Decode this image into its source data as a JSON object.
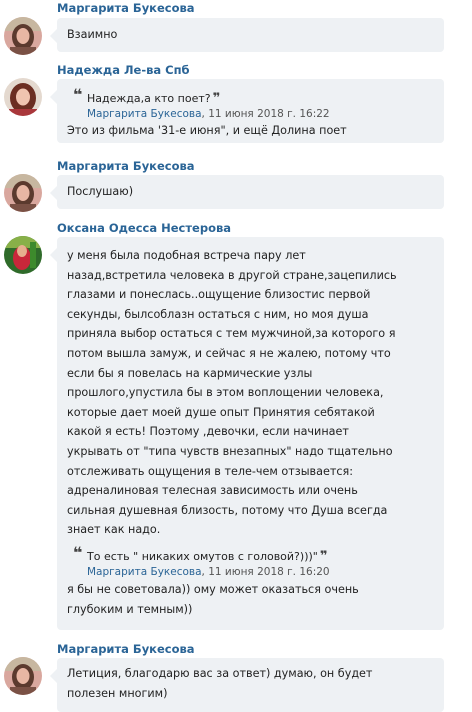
{
  "messages": [
    {
      "author": "Маргарита Букесова",
      "avatar": "avatar-margarita",
      "text_lines": [
        "Взаимно"
      ]
    },
    {
      "author": "Надежда Ле-ва Спб",
      "avatar": "avatar-nadezhda",
      "quote": {
        "text": "Надежда,а кто поет?",
        "author": "Маргарита Букесова",
        "date": ", 11 июня 2018 г. 16:22"
      },
      "text_lines": [
        "Это из фильма '31-е июня\", и ещё Долина поет"
      ]
    },
    {
      "author": "Маргарита Букесова",
      "avatar": "avatar-margarita",
      "text_lines": [
        "Послушаю)"
      ]
    },
    {
      "author": "Оксана Одесса Нестерова",
      "avatar": "avatar-oksana",
      "text_lines": [
        "у меня была подобная встреча пару лет",
        "назад,встретила человека в другой стране,зацепились",
        "глазами и понеслась..ощущение близостис первой",
        "секунды, былсоблазн остаться с ним, но моя душа",
        "приняла выбор остаться с тем мужчиной,за которого я",
        "потом вышла замуж, и сейчас я не жалею, потому что",
        "если бы я повелась на кармические узлы",
        "прошлого,упустила бы в этом воплощении человека,",
        "которые дает моей душе опыт Принятия себятакой",
        "какой я есть! Поэтому ,девочки, если начинает",
        "укрывать от \"типа чувств внезапных\" надо тщательно",
        "отслеживать ощущения в теле-чем отзывается:",
        "адреналиновая телесная  зависимость или очень",
        "сильная душевная близость, потому что Душа всегда",
        "знает как надо."
      ],
      "quote": {
        "text": "То есть \" никаких омутов с головой?)))\"",
        "author": "Маргарита Букесова",
        "date": ", 11 июня 2018 г. 16:20"
      },
      "after_lines": [
        "я бы не советовала)) ому может оказаться очень",
        "глубоким и темным))"
      ]
    },
    {
      "author": "Маргарита Букесова",
      "avatar": "avatar-margarita",
      "text_lines": [
        "Летиция, благодарю вас за ответ) думаю, он будет",
        "полезен многим)"
      ]
    }
  ],
  "colors": {
    "author_link": "#2a6496",
    "bubble_bg": "#eef1f4"
  }
}
